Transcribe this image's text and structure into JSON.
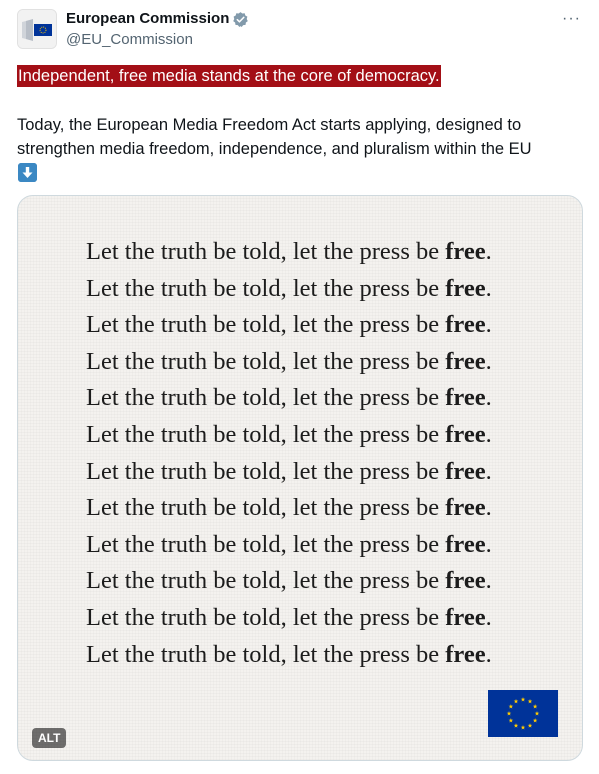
{
  "tweet": {
    "display_name": "European Commission",
    "handle": "@EU_Commission",
    "highlight": "Independent, free media stands at the core of democracy.",
    "body": "Today, the European Media Freedom Act starts applying, designed to strengthen media freedom, independence, and pluralism within the EU",
    "more_label": "···"
  },
  "media": {
    "line_prefix": "Let the truth be told, let the press be ",
    "line_bold": "free",
    "line_suffix": ".",
    "line_count": 12,
    "alt_label": "ALT"
  },
  "colors": {
    "highlight_bg": "#a30f16",
    "verified": "#829aab",
    "eu_blue": "#003399",
    "eu_star": "#ffcc00"
  },
  "icons": [
    "eu-logo-avatar-icon",
    "verified-badge-icon",
    "more-options-icon",
    "down-arrow-emoji-icon",
    "eu-flag-icon"
  ]
}
